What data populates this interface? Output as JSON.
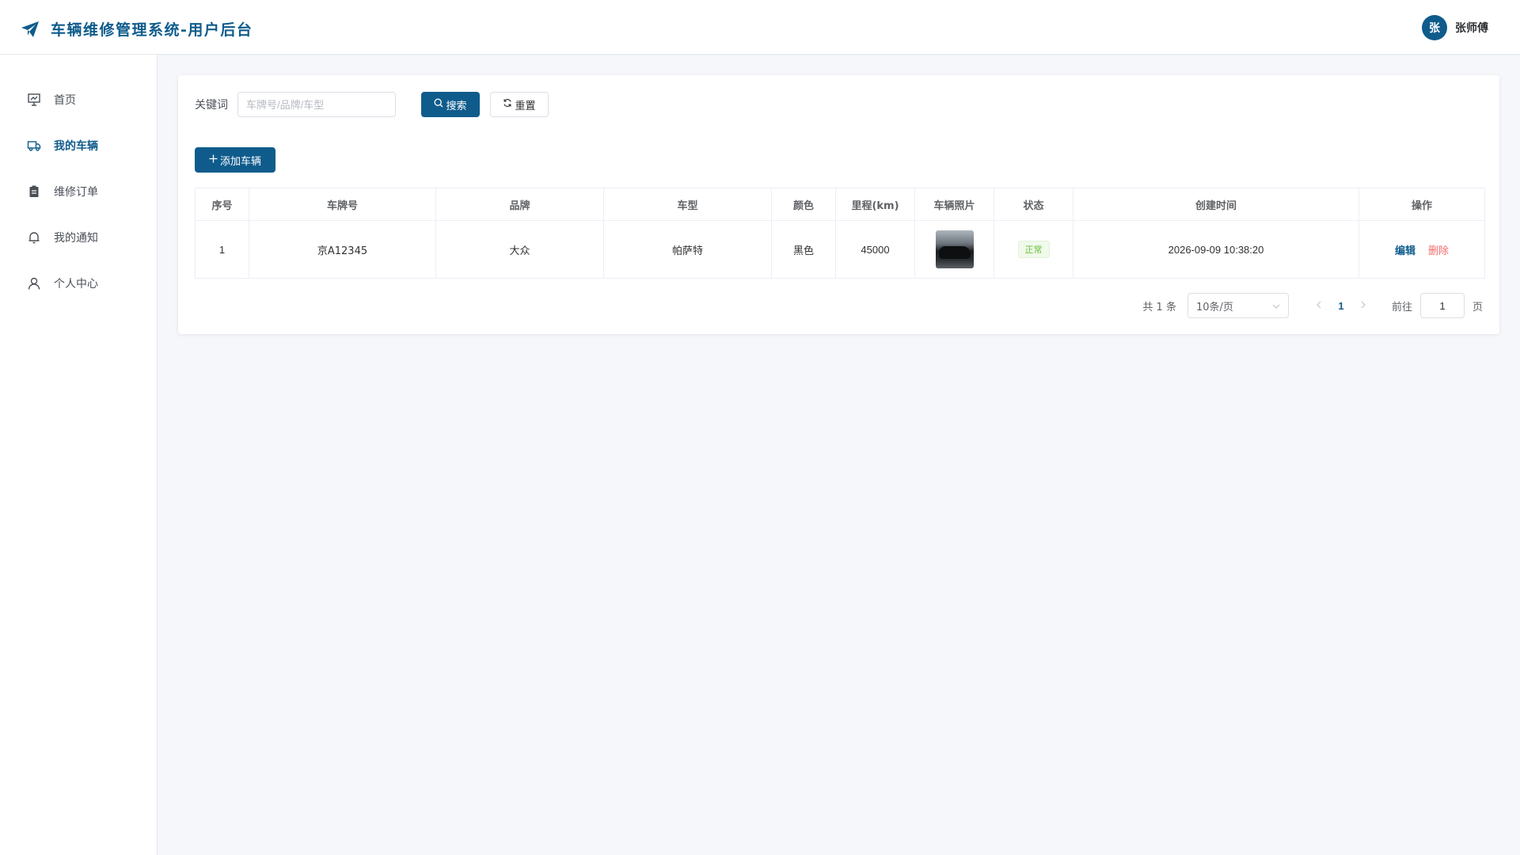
{
  "header": {
    "title": "车辆维修管理系统-用户后台",
    "user": {
      "avatar_text": "张",
      "name": "张师傅"
    }
  },
  "sidebar": {
    "items": [
      {
        "label": "首页",
        "icon": "presentation-icon"
      },
      {
        "label": "我的车辆",
        "icon": "truck-icon",
        "active": true
      },
      {
        "label": "维修订单",
        "icon": "clipboard-icon"
      },
      {
        "label": "我的通知",
        "icon": "bell-icon"
      },
      {
        "label": "个人中心",
        "icon": "user-icon"
      }
    ]
  },
  "search": {
    "label": "关键词",
    "placeholder": "车牌号/品牌/车型",
    "value": "",
    "search_button": "搜索",
    "reset_button": "重置"
  },
  "toolbar": {
    "add_button": "添加车辆"
  },
  "table": {
    "columns": [
      "序号",
      "车牌号",
      "品牌",
      "车型",
      "颜色",
      "里程(km)",
      "车辆照片",
      "状态",
      "创建时间",
      "操作"
    ],
    "rows": [
      {
        "index": "1",
        "plate": "京A12345",
        "brand": "大众",
        "model": "帕萨特",
        "color": "黑色",
        "mileage": "45000",
        "status": "正常",
        "created_at": "2026-09-09 10:38:20",
        "edit": "编辑",
        "delete": "删除"
      }
    ]
  },
  "pagination": {
    "total_text": "共 1 条",
    "page_size": "10条/页",
    "current_page": "1",
    "goto_label": "前往",
    "goto_value": "1",
    "page_suffix": "页"
  },
  "colors": {
    "primary": "#0f5c8c",
    "danger": "#f56c6c",
    "success": "#67c23a"
  }
}
